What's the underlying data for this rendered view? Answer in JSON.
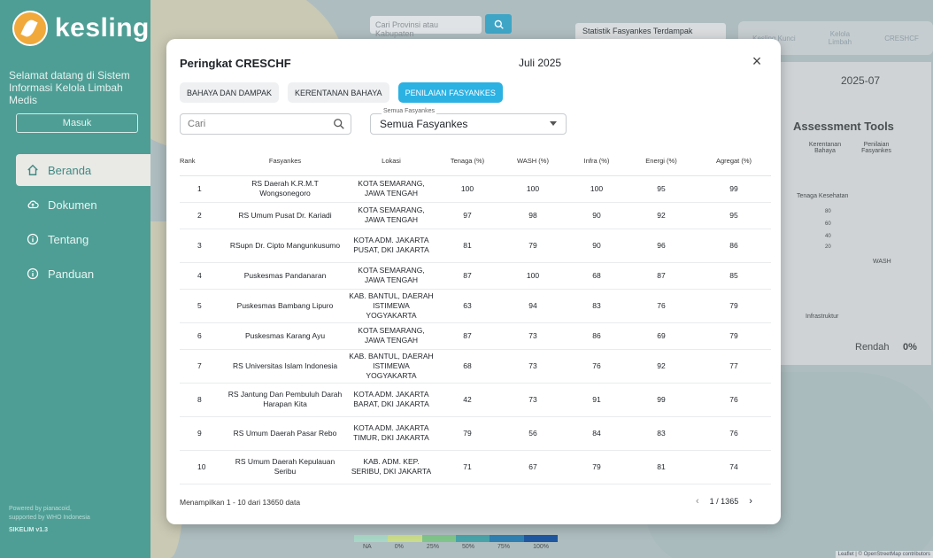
{
  "sidebar": {
    "brand": "kesling",
    "welcome": "Selamat datang di Sistem Informasi Kelola Limbah Medis",
    "login_label": "Masuk",
    "nav": [
      {
        "label": "Beranda",
        "icon": "home-icon"
      },
      {
        "label": "Dokumen",
        "icon": "cloud-icon"
      },
      {
        "label": "Tentang",
        "icon": "info-icon"
      },
      {
        "label": "Panduan",
        "icon": "info-icon"
      }
    ],
    "footer_line1": "Powered by pianacoid,",
    "footer_line2": "supported by WHO Indonesia",
    "version": "SIKELIM v1.3"
  },
  "map": {
    "search_placeholder": "Cari Provinsi atau Kabupaten",
    "stat_label": "Statistik Fasyankes Terdampak",
    "top_tabs": [
      "Kesling Kunci",
      "Kelola Limbah",
      "CRESHCF"
    ],
    "date_value": "2025-07",
    "tools_title": "Assessment Tools",
    "tools_tabs": [
      "Kerentanan Bahaya",
      "Penilaian Fasyankes"
    ],
    "radar_labels": [
      "Tenaga Kesehatan",
      "WASH",
      "Infrastruktur"
    ],
    "radar_ticks": [
      "80",
      "60",
      "40",
      "20"
    ],
    "summary_label": "Rendah",
    "summary_value": "0%",
    "legend": [
      "NA",
      "0%",
      "25%",
      "50%",
      "75%",
      "100%"
    ],
    "legend_colors": [
      "#a8d6c6",
      "#c9dc8a",
      "#7fc48a",
      "#47a3a8",
      "#2f7fb2",
      "#1f57a0"
    ],
    "attribution": "Leaflet | © OpenStreetMap contributors"
  },
  "modal": {
    "title": "Peringkat CRESCHF",
    "date": "Juli 2025",
    "tabs": [
      "BAHAYA DAN DAMPAK",
      "KERENTANAN BAHAYA",
      "PENILAIAN FASYANKES"
    ],
    "search_placeholder": "Cari",
    "filter_label": "Semua Fasyankes",
    "filter_value": "Semua Fasyankes",
    "columns": [
      "Rank",
      "Fasyankes",
      "Lokasi",
      "Tenaga (%)",
      "WASH (%)",
      "Infra (%)",
      "Energi (%)",
      "Agregat (%)"
    ],
    "rows": [
      {
        "rank": "1",
        "name": "RS Daerah K.R.M.T Wongsonegoro",
        "loc": "KOTA SEMARANG, JAWA TENGAH",
        "tenaga": "100",
        "wash": "100",
        "infra": "100",
        "energi": "95",
        "agregat": "99"
      },
      {
        "rank": "2",
        "name": "RS Umum Pusat Dr. Kariadi",
        "loc": "KOTA SEMARANG, JAWA TENGAH",
        "tenaga": "97",
        "wash": "98",
        "infra": "90",
        "energi": "92",
        "agregat": "95"
      },
      {
        "rank": "3",
        "name": "RSupn Dr. Cipto Mangunkusumo",
        "loc": "KOTA ADM. JAKARTA PUSAT, DKI JAKARTA",
        "tenaga": "81",
        "wash": "79",
        "infra": "90",
        "energi": "96",
        "agregat": "86"
      },
      {
        "rank": "4",
        "name": "Puskesmas Pandanaran",
        "loc": "KOTA SEMARANG, JAWA TENGAH",
        "tenaga": "87",
        "wash": "100",
        "infra": "68",
        "energi": "87",
        "agregat": "85"
      },
      {
        "rank": "5",
        "name": "Puskesmas Bambang Lipuro",
        "loc": "KAB. BANTUL, DAERAH ISTIMEWA YOGYAKARTA",
        "tenaga": "63",
        "wash": "94",
        "infra": "83",
        "energi": "76",
        "agregat": "79"
      },
      {
        "rank": "6",
        "name": "Puskesmas Karang Ayu",
        "loc": "KOTA SEMARANG, JAWA TENGAH",
        "tenaga": "87",
        "wash": "73",
        "infra": "86",
        "energi": "69",
        "agregat": "79"
      },
      {
        "rank": "7",
        "name": "RS Universitas Islam Indonesia",
        "loc": "KAB. BANTUL, DAERAH ISTIMEWA YOGYAKARTA",
        "tenaga": "68",
        "wash": "73",
        "infra": "76",
        "energi": "92",
        "agregat": "77"
      },
      {
        "rank": "8",
        "name": "RS Jantung Dan Pembuluh Darah Harapan Kita",
        "loc": "KOTA ADM. JAKARTA BARAT, DKI JAKARTA",
        "tenaga": "42",
        "wash": "73",
        "infra": "91",
        "energi": "99",
        "agregat": "76"
      },
      {
        "rank": "9",
        "name": "RS Umum Daerah Pasar Rebo",
        "loc": "KOTA ADM. JAKARTA TIMUR, DKI JAKARTA",
        "tenaga": "79",
        "wash": "56",
        "infra": "84",
        "energi": "83",
        "agregat": "76"
      },
      {
        "rank": "10",
        "name": "RS Umum Daerah Kepulauan Seribu",
        "loc": "KAB. ADM. KEP. SERIBU, DKI JAKARTA",
        "tenaga": "71",
        "wash": "67",
        "infra": "79",
        "energi": "81",
        "agregat": "74"
      }
    ],
    "footer_text": "Menampilkan 1 - 10 dari 13650 data",
    "page_label": "1 / 1365"
  },
  "colors": {
    "sidebar": "#4e9e95",
    "accent": "#2cb1e3"
  }
}
